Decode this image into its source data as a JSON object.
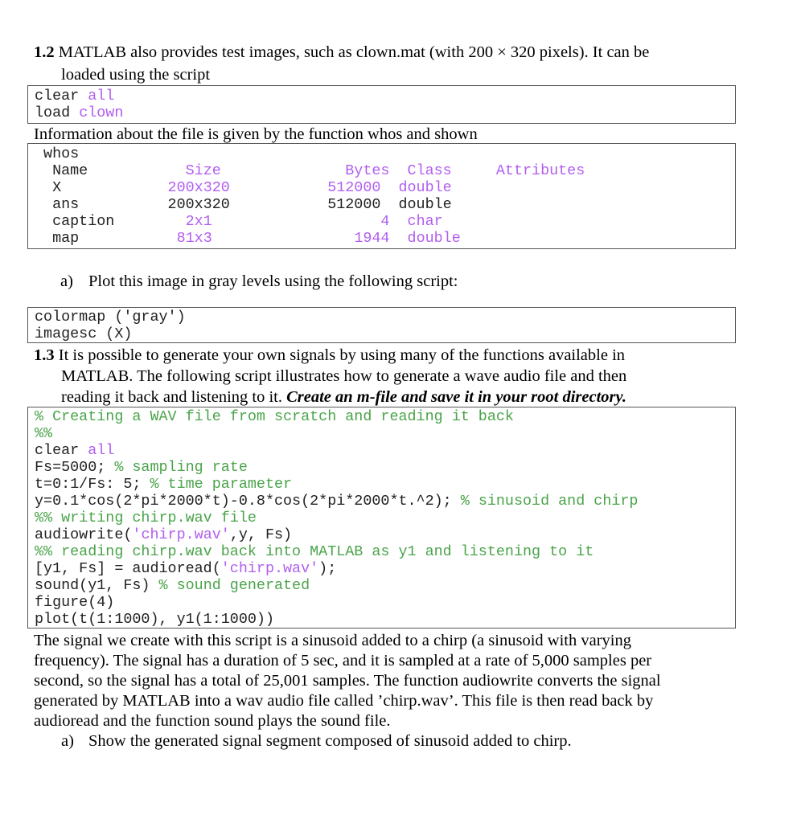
{
  "section_1_2": {
    "number": "1.2",
    "line1": " MATLAB also provides test images, such as clown.mat (with 200 × 320 pixels). It can be",
    "line2": "loaded using the script",
    "code": [
      [
        {
          "t": "clear ",
          "k": "p"
        },
        {
          "t": "all",
          "k": "k"
        }
      ],
      [
        {
          "t": "load ",
          "k": "p"
        },
        {
          "t": "clown",
          "k": "k"
        }
      ]
    ],
    "info_text": "Information about the file is given by the function whos and shown",
    "whos": [
      [
        {
          "t": " whos",
          "k": "p"
        }
      ],
      [
        {
          "t": "  Name           ",
          "k": "p"
        },
        {
          "t": "Size              Bytes  Class     Attributes",
          "k": "k"
        }
      ],
      [
        {
          "t": "  X            ",
          "k": "p"
        },
        {
          "t": "200x320           512000  double",
          "k": "k"
        }
      ],
      [
        {
          "t": "  ans          200x320           512000  double",
          "k": "p"
        }
      ],
      [
        {
          "t": "  caption        ",
          "k": "p"
        },
        {
          "t": "2x1                   4  char",
          "k": "k"
        }
      ],
      [
        {
          "t": "  map           ",
          "k": "p"
        },
        {
          "t": "81x3                1944  double",
          "k": "k"
        }
      ]
    ],
    "task_a_label": "a)",
    "task_a_text": "Plot this image in gray levels using  the following script:",
    "code2": [
      [
        {
          "t": "colormap ('gray')",
          "k": "p"
        }
      ],
      [
        {
          "t": "imagesc (X)",
          "k": "p"
        }
      ]
    ]
  },
  "section_1_3": {
    "number": "1.3",
    "line1": " It is possible to generate your own signals by using many of the functions available in",
    "line2": "MATLAB. The following script illustrates how to generate a wave audio file and then",
    "line3_plain": "reading it back and listening to it. ",
    "line3_emph": "Create an m-file and save it in your root directory.",
    "code": [
      [
        {
          "t": "% Creating a WAV file from scratch and reading it back",
          "k": "c"
        }
      ],
      [
        {
          "t": "%%",
          "k": "c"
        }
      ],
      [
        {
          "t": "clear ",
          "k": "p"
        },
        {
          "t": "all",
          "k": "k"
        }
      ],
      [
        {
          "t": "Fs=5000; ",
          "k": "p"
        },
        {
          "t": "% sampling rate",
          "k": "c"
        }
      ],
      [
        {
          "t": "t=0:1/Fs: 5; ",
          "k": "p"
        },
        {
          "t": "% time parameter",
          "k": "c"
        }
      ],
      [
        {
          "t": "y=0.1*cos(2*pi*2000*t)-0.8*cos(2*pi*2000*t.^2); ",
          "k": "p"
        },
        {
          "t": "% sinusoid and chirp",
          "k": "c"
        }
      ],
      [
        {
          "t": "%% writing chirp.wav file",
          "k": "c"
        }
      ],
      [
        {
          "t": "audiowrite(",
          "k": "p"
        },
        {
          "t": "'chirp.wav'",
          "k": "s"
        },
        {
          "t": ",y, Fs)",
          "k": "p"
        }
      ],
      [
        {
          "t": "%% reading chirp.wav back into MATLAB as y1 and listening to it",
          "k": "c"
        }
      ],
      [
        {
          "t": "[y1, Fs] = audioread(",
          "k": "p"
        },
        {
          "t": "'chirp.wav'",
          "k": "s"
        },
        {
          "t": ");",
          "k": "p"
        }
      ],
      [
        {
          "t": "sound(y1, Fs) ",
          "k": "p"
        },
        {
          "t": "% sound generated",
          "k": "c"
        }
      ],
      [
        {
          "t": "figure(4)",
          "k": "p"
        }
      ],
      [
        {
          "t": "plot(t(1:1000), y1(1:1000))",
          "k": "p"
        }
      ]
    ],
    "paragraph": [
      "The signal we create with this script is a sinusoid added to a chirp (a sinusoid with varying",
      "frequency). The signal has a duration of 5 sec, and it is sampled at a rate of 5,000 samples per",
      "second, so the signal has a total of 25,001 samples. The function audiowrite converts the signal",
      "generated by MATLAB into a wav audio file called ’chirp.wav’. This file is then read back by",
      "audioread and the function sound plays the sound file."
    ],
    "task_a_label": "a)",
    "task_a_text": "Show the generated signal segment composed of sinusoid added to chirp."
  },
  "colors": {
    "keyword_string": "#b25ef0",
    "comment": "#4aa44a",
    "text": "#000000"
  }
}
